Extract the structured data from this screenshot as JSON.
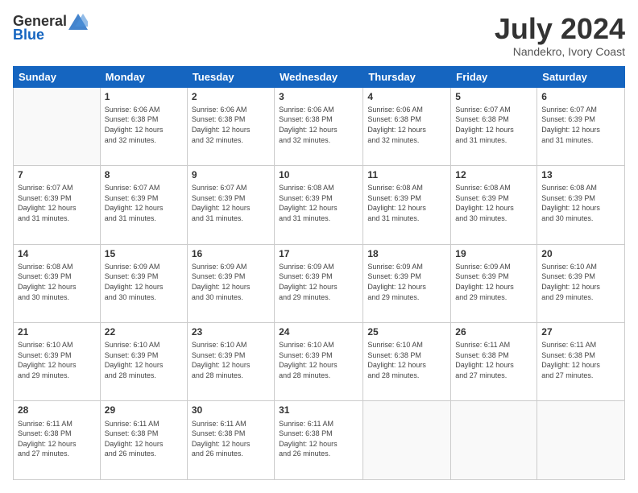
{
  "header": {
    "logo_general": "General",
    "logo_blue": "Blue",
    "month_title": "July 2024",
    "location": "Nandekro, Ivory Coast"
  },
  "days_of_week": [
    "Sunday",
    "Monday",
    "Tuesday",
    "Wednesday",
    "Thursday",
    "Friday",
    "Saturday"
  ],
  "weeks": [
    [
      {
        "day": "",
        "info": ""
      },
      {
        "day": "1",
        "info": "Sunrise: 6:06 AM\nSunset: 6:38 PM\nDaylight: 12 hours\nand 32 minutes."
      },
      {
        "day": "2",
        "info": "Sunrise: 6:06 AM\nSunset: 6:38 PM\nDaylight: 12 hours\nand 32 minutes."
      },
      {
        "day": "3",
        "info": "Sunrise: 6:06 AM\nSunset: 6:38 PM\nDaylight: 12 hours\nand 32 minutes."
      },
      {
        "day": "4",
        "info": "Sunrise: 6:06 AM\nSunset: 6:38 PM\nDaylight: 12 hours\nand 32 minutes."
      },
      {
        "day": "5",
        "info": "Sunrise: 6:07 AM\nSunset: 6:38 PM\nDaylight: 12 hours\nand 31 minutes."
      },
      {
        "day": "6",
        "info": "Sunrise: 6:07 AM\nSunset: 6:39 PM\nDaylight: 12 hours\nand 31 minutes."
      }
    ],
    [
      {
        "day": "7",
        "info": "Sunrise: 6:07 AM\nSunset: 6:39 PM\nDaylight: 12 hours\nand 31 minutes."
      },
      {
        "day": "8",
        "info": "Sunrise: 6:07 AM\nSunset: 6:39 PM\nDaylight: 12 hours\nand 31 minutes."
      },
      {
        "day": "9",
        "info": "Sunrise: 6:07 AM\nSunset: 6:39 PM\nDaylight: 12 hours\nand 31 minutes."
      },
      {
        "day": "10",
        "info": "Sunrise: 6:08 AM\nSunset: 6:39 PM\nDaylight: 12 hours\nand 31 minutes."
      },
      {
        "day": "11",
        "info": "Sunrise: 6:08 AM\nSunset: 6:39 PM\nDaylight: 12 hours\nand 31 minutes."
      },
      {
        "day": "12",
        "info": "Sunrise: 6:08 AM\nSunset: 6:39 PM\nDaylight: 12 hours\nand 30 minutes."
      },
      {
        "day": "13",
        "info": "Sunrise: 6:08 AM\nSunset: 6:39 PM\nDaylight: 12 hours\nand 30 minutes."
      }
    ],
    [
      {
        "day": "14",
        "info": "Sunrise: 6:08 AM\nSunset: 6:39 PM\nDaylight: 12 hours\nand 30 minutes."
      },
      {
        "day": "15",
        "info": "Sunrise: 6:09 AM\nSunset: 6:39 PM\nDaylight: 12 hours\nand 30 minutes."
      },
      {
        "day": "16",
        "info": "Sunrise: 6:09 AM\nSunset: 6:39 PM\nDaylight: 12 hours\nand 30 minutes."
      },
      {
        "day": "17",
        "info": "Sunrise: 6:09 AM\nSunset: 6:39 PM\nDaylight: 12 hours\nand 29 minutes."
      },
      {
        "day": "18",
        "info": "Sunrise: 6:09 AM\nSunset: 6:39 PM\nDaylight: 12 hours\nand 29 minutes."
      },
      {
        "day": "19",
        "info": "Sunrise: 6:09 AM\nSunset: 6:39 PM\nDaylight: 12 hours\nand 29 minutes."
      },
      {
        "day": "20",
        "info": "Sunrise: 6:10 AM\nSunset: 6:39 PM\nDaylight: 12 hours\nand 29 minutes."
      }
    ],
    [
      {
        "day": "21",
        "info": "Sunrise: 6:10 AM\nSunset: 6:39 PM\nDaylight: 12 hours\nand 29 minutes."
      },
      {
        "day": "22",
        "info": "Sunrise: 6:10 AM\nSunset: 6:39 PM\nDaylight: 12 hours\nand 28 minutes."
      },
      {
        "day": "23",
        "info": "Sunrise: 6:10 AM\nSunset: 6:39 PM\nDaylight: 12 hours\nand 28 minutes."
      },
      {
        "day": "24",
        "info": "Sunrise: 6:10 AM\nSunset: 6:39 PM\nDaylight: 12 hours\nand 28 minutes."
      },
      {
        "day": "25",
        "info": "Sunrise: 6:10 AM\nSunset: 6:38 PM\nDaylight: 12 hours\nand 28 minutes."
      },
      {
        "day": "26",
        "info": "Sunrise: 6:11 AM\nSunset: 6:38 PM\nDaylight: 12 hours\nand 27 minutes."
      },
      {
        "day": "27",
        "info": "Sunrise: 6:11 AM\nSunset: 6:38 PM\nDaylight: 12 hours\nand 27 minutes."
      }
    ],
    [
      {
        "day": "28",
        "info": "Sunrise: 6:11 AM\nSunset: 6:38 PM\nDaylight: 12 hours\nand 27 minutes."
      },
      {
        "day": "29",
        "info": "Sunrise: 6:11 AM\nSunset: 6:38 PM\nDaylight: 12 hours\nand 26 minutes."
      },
      {
        "day": "30",
        "info": "Sunrise: 6:11 AM\nSunset: 6:38 PM\nDaylight: 12 hours\nand 26 minutes."
      },
      {
        "day": "31",
        "info": "Sunrise: 6:11 AM\nSunset: 6:38 PM\nDaylight: 12 hours\nand 26 minutes."
      },
      {
        "day": "",
        "info": ""
      },
      {
        "day": "",
        "info": ""
      },
      {
        "day": "",
        "info": ""
      }
    ]
  ]
}
